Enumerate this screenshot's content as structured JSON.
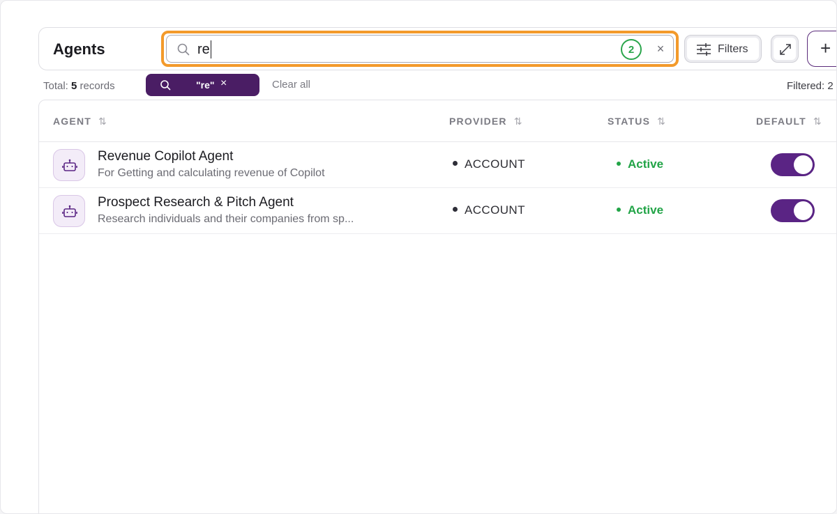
{
  "page": {
    "title": "Agents"
  },
  "search": {
    "value": "re",
    "result_count": "2",
    "clear_symbol": "×"
  },
  "toolbar": {
    "filters_label": "Filters",
    "add_symbol": "+"
  },
  "summary": {
    "total_prefix": "Total:",
    "total_count": "5",
    "total_suffix": "records",
    "filtered_label": "Filtered: 2"
  },
  "active_filter": {
    "text": "\"re\"",
    "remove_symbol": "×"
  },
  "clear_all_label": "Clear all",
  "table": {
    "columns": {
      "agent": "AGENT",
      "provider": "PROVIDER",
      "status": "STATUS",
      "default": "DEFAULT"
    },
    "rows": [
      {
        "name": "Revenue Copilot Agent",
        "description": "For Getting and calculating revenue of Copilot",
        "provider": "ACCOUNT",
        "status": "Active",
        "default_on": true
      },
      {
        "name": "Prospect Research & Pitch Agent",
        "description": "Research individuals and their companies from sp...",
        "provider": "ACCOUNT",
        "status": "Active",
        "default_on": true
      }
    ]
  },
  "colors": {
    "brand": "#5a2484",
    "chip": "#4a1d64",
    "focus_outline": "#f39a2b",
    "status_active": "#22a447"
  }
}
